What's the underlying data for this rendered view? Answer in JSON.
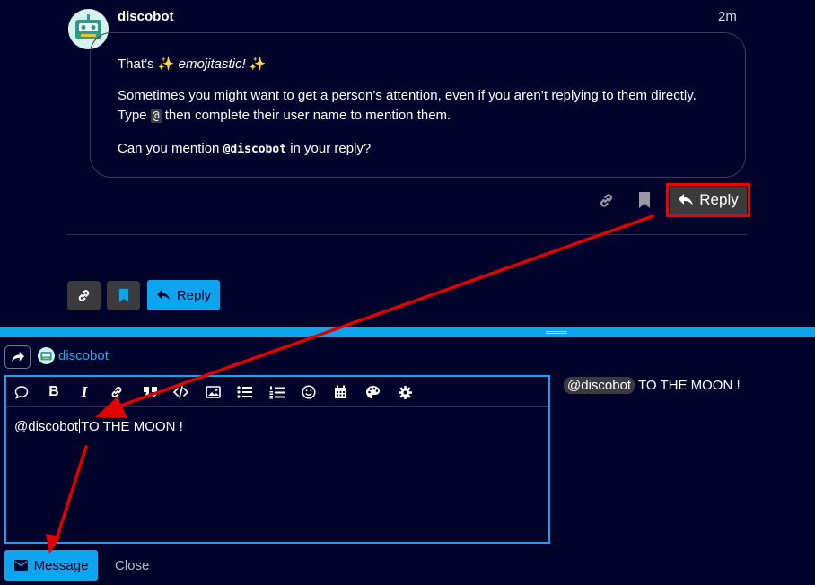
{
  "post": {
    "username": "discobot",
    "time": "2m",
    "line1_prefix": "That’s",
    "line1_sparkle": "✨",
    "line1_em": "emojitastic!",
    "line2": "Sometimes you might want to get a person’s attention, even if you aren’t replying to them directly.",
    "line3_prefix": "Type",
    "line3_code": "@",
    "line3_suffix": "then complete their user name to mention them.",
    "line4_prefix": "Can you mention",
    "line4_mention": "@discobot",
    "line4_suffix": "in your reply?",
    "reply_label": "Reply"
  },
  "topic_actions": {
    "reply_label": "Reply"
  },
  "composer": {
    "reply_to_user": "discobot",
    "editor_mention": "@discobot",
    "editor_text": "TO THE MOON !",
    "preview_mention": "@discobot",
    "preview_text": "TO THE MOON !",
    "submit_label": "Message",
    "close_label": "Close"
  },
  "colors": {
    "background": "#01032b",
    "accent": "#0da5ef",
    "annotation": "#e00000"
  }
}
